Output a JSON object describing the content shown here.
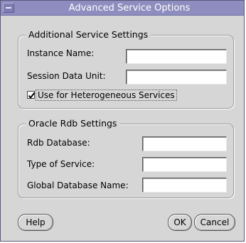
{
  "window": {
    "title": "Advanced Service Options"
  },
  "additional_settings": {
    "group_title": "Additional Service Settings",
    "instance_name_label": "Instance Name:",
    "instance_name_value": "",
    "session_data_unit_label": "Session Data Unit:",
    "session_data_unit_value": "",
    "heterogeneous_label": "Use for Heterogeneous Services",
    "heterogeneous_checked": true
  },
  "rdb_settings": {
    "group_title": "Oracle Rdb Settings",
    "rdb_database_label": "Rdb Database:",
    "rdb_database_value": "",
    "type_of_service_label": "Type of Service:",
    "type_of_service_value": "",
    "global_db_name_label": "Global Database Name:",
    "global_db_name_value": ""
  },
  "buttons": {
    "help": "Help",
    "ok": "OK",
    "cancel": "Cancel"
  },
  "colors": {
    "titlebar": "#8d8dbf",
    "window_bg": "#d6d6d6"
  },
  "icons": {
    "window_menu": "window-menu-icon",
    "checkmark": "checkmark-icon"
  }
}
